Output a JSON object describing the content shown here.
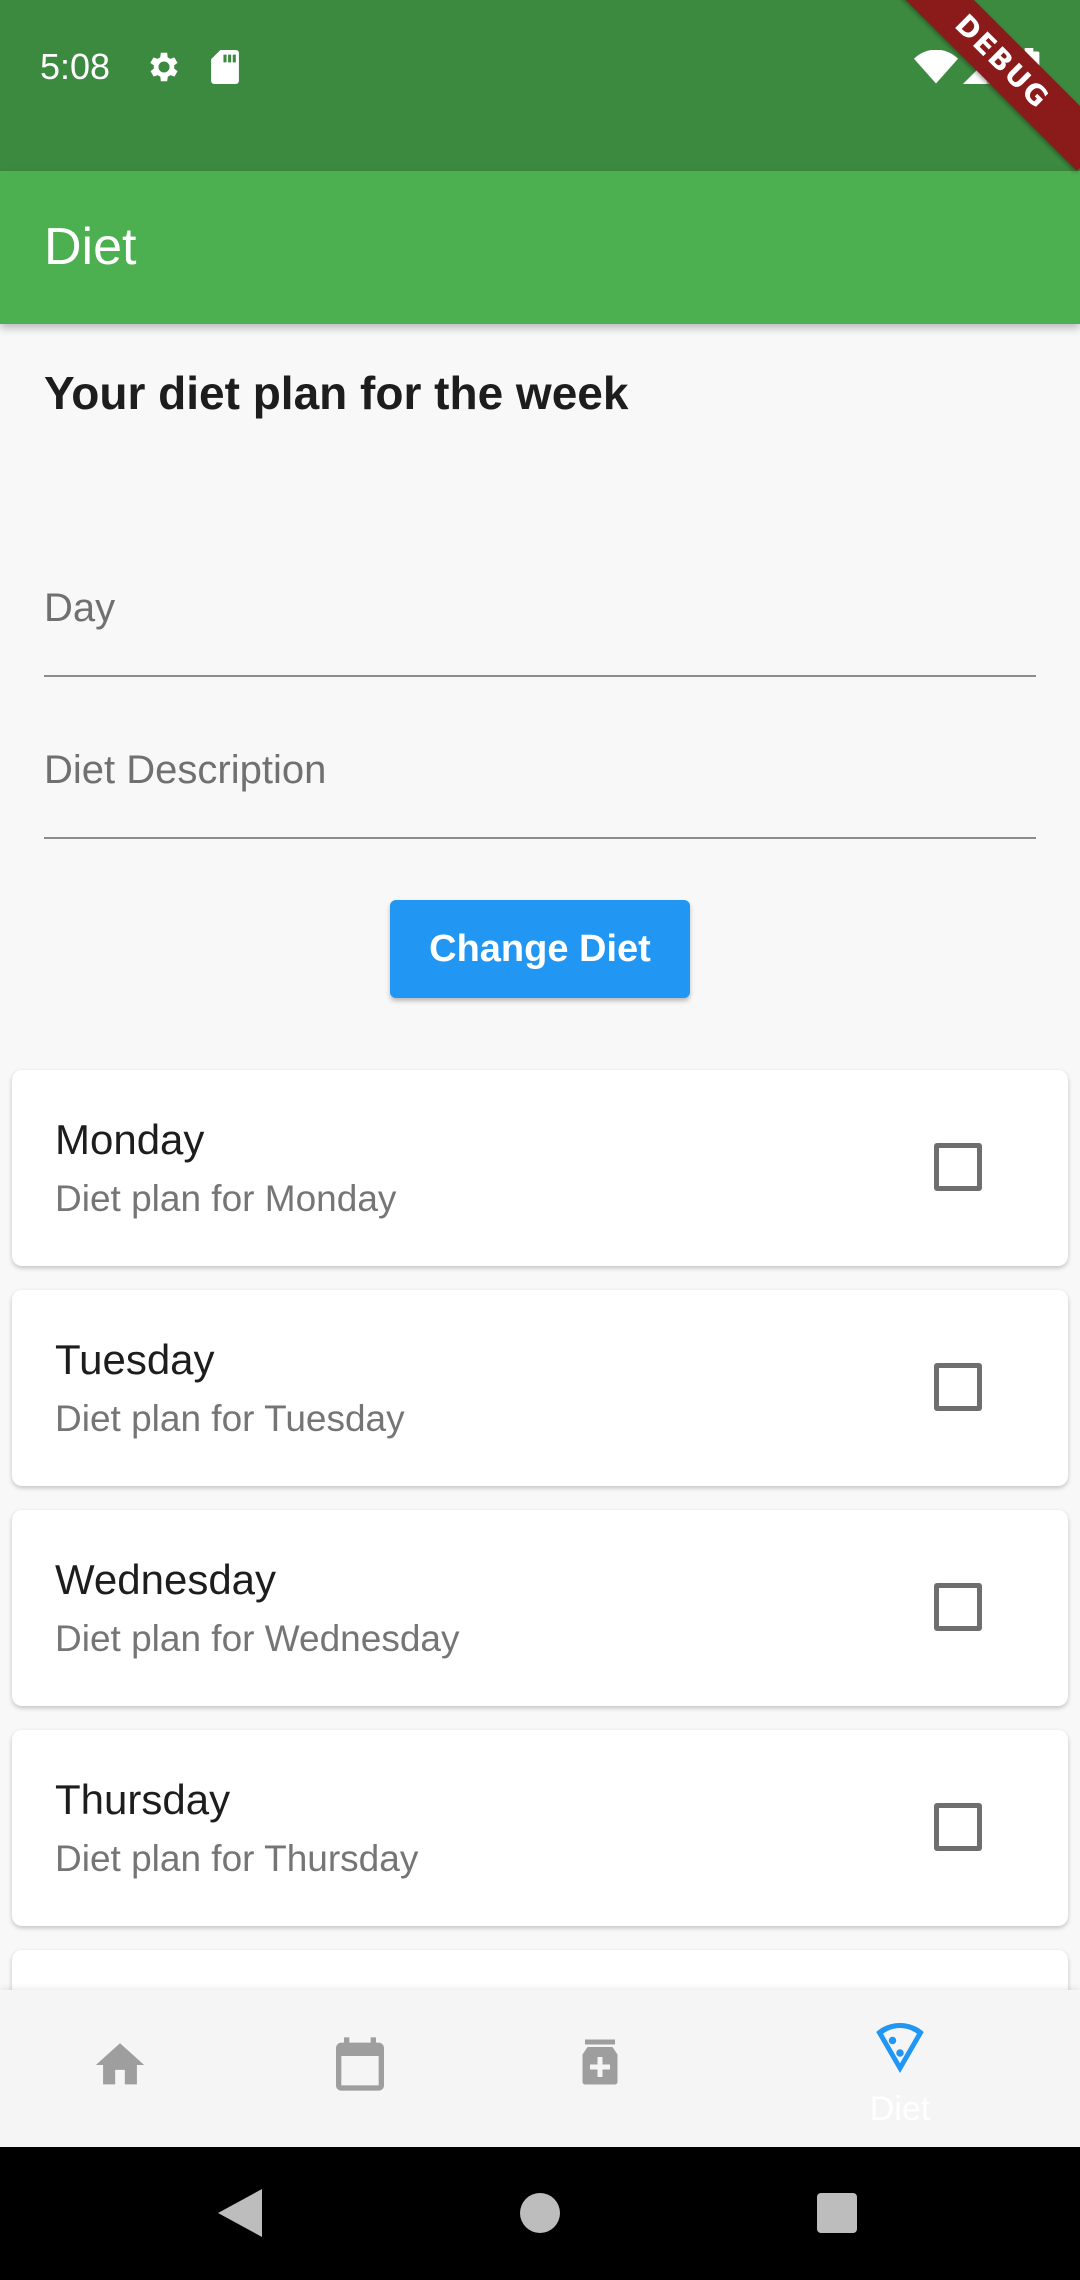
{
  "status_bar": {
    "time": "5:08",
    "debug_label": "DEBUG"
  },
  "app_bar": {
    "title": "Diet"
  },
  "heading": "Your diet plan for the week",
  "form": {
    "day_placeholder": "Day",
    "description_placeholder": "Diet Description",
    "button_label": "Change Diet"
  },
  "days": [
    {
      "title": "Monday",
      "subtitle": "Diet plan for Monday",
      "checked": false
    },
    {
      "title": "Tuesday",
      "subtitle": "Diet plan for Tuesday",
      "checked": false
    },
    {
      "title": "Wednesday",
      "subtitle": "Diet plan for Wednesday",
      "checked": false
    },
    {
      "title": "Thursday",
      "subtitle": "Diet plan for Thursday",
      "checked": false
    }
  ],
  "bottom_nav": {
    "items": [
      {
        "icon": "home-icon"
      },
      {
        "icon": "calendar-icon"
      },
      {
        "icon": "medicine-icon"
      },
      {
        "icon": "pizza-icon",
        "label": "Diet",
        "active": true
      }
    ]
  },
  "colors": {
    "status_bar": "#3c8a3f",
    "app_bar": "#4caf50",
    "button": "#2196f3",
    "active_nav": "#2196f3",
    "inactive_nav": "#9e9e9e"
  }
}
